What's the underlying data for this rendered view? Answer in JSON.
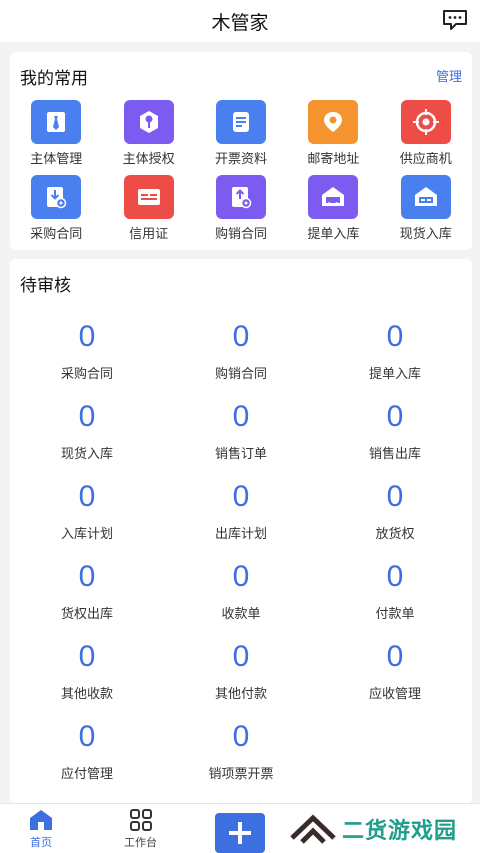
{
  "header": {
    "title": "木管家"
  },
  "common": {
    "title": "我的常用",
    "manage": "管理",
    "items": [
      {
        "label": "主体管理",
        "icon": "tie-icon",
        "color": "#4a7ff0"
      },
      {
        "label": "主体授权",
        "icon": "key-icon",
        "color": "#7c5cf0"
      },
      {
        "label": "开票资料",
        "icon": "document-icon",
        "color": "#4a7ff0"
      },
      {
        "label": "邮寄地址",
        "icon": "location-pin-icon",
        "color": "#f5932e"
      },
      {
        "label": "供应商机",
        "icon": "target-icon",
        "color": "#ee4c47"
      },
      {
        "label": "采购合同",
        "icon": "contract-download-icon",
        "color": "#4a7ff0"
      },
      {
        "label": "信用证",
        "icon": "card-icon",
        "color": "#ee4c47"
      },
      {
        "label": "购销合同",
        "icon": "contract-upload-icon",
        "color": "#7c5cf0"
      },
      {
        "label": "提单入库",
        "icon": "warehouse-truck-icon",
        "color": "#7c5cf0"
      },
      {
        "label": "现货入库",
        "icon": "warehouse-icon",
        "color": "#4a7ff0"
      }
    ]
  },
  "pending": {
    "title": "待审核",
    "items": [
      {
        "count": "0",
        "label": "采购合同"
      },
      {
        "count": "0",
        "label": "购销合同"
      },
      {
        "count": "0",
        "label": "提单入库"
      },
      {
        "count": "0",
        "label": "现货入库"
      },
      {
        "count": "0",
        "label": "销售订单"
      },
      {
        "count": "0",
        "label": "销售出库"
      },
      {
        "count": "0",
        "label": "入库计划"
      },
      {
        "count": "0",
        "label": "出库计划"
      },
      {
        "count": "0",
        "label": "放货权"
      },
      {
        "count": "0",
        "label": "货权出库"
      },
      {
        "count": "0",
        "label": "收款单"
      },
      {
        "count": "0",
        "label": "付款单"
      },
      {
        "count": "0",
        "label": "其他收款"
      },
      {
        "count": "0",
        "label": "其他付款"
      },
      {
        "count": "0",
        "label": "应收管理"
      },
      {
        "count": "0",
        "label": "应付管理"
      },
      {
        "count": "0",
        "label": "销项票开票"
      }
    ]
  },
  "tabbar": {
    "home": "首页",
    "workbench": "工作台"
  },
  "watermark": {
    "text": "二货游戏园"
  },
  "accent": "#3d6fe0"
}
